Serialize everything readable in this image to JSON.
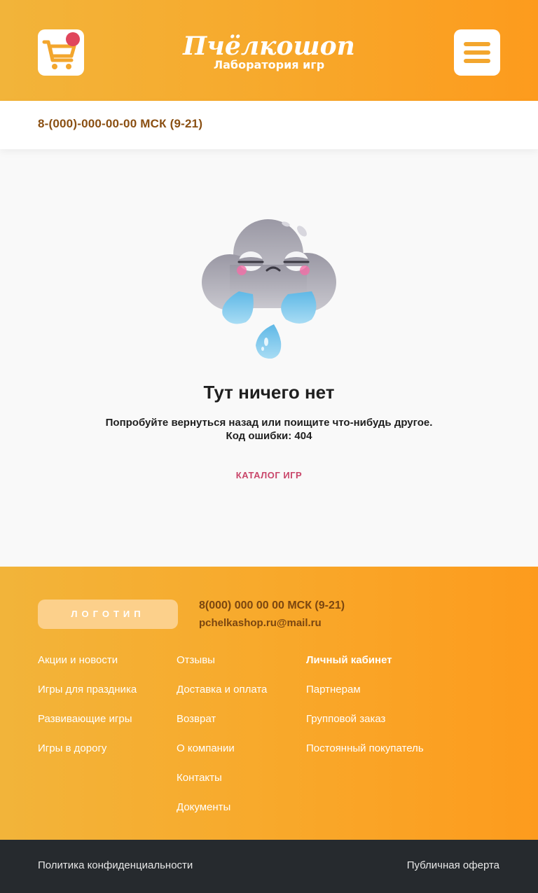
{
  "header": {
    "logo_name": "Пчёлкошоп",
    "logo_subtitle": "Лаборатория игр",
    "cart_icon": "cart-icon",
    "menu_icon": "hamburger-icon",
    "accent": "#f7a92c",
    "badge_color": "#e0465c"
  },
  "phone_bar": {
    "phone": "8-(000)-000-00-00 МСК (9-21)"
  },
  "error": {
    "illustration": "sad-cloud-icon",
    "title": "Тут ничего нет",
    "message": "Попробуйте вернуться назад или поищите что-нибудь другое.",
    "code_line": "Код ошибки: 404",
    "catalog_link": "КАТАЛОГ ИГР"
  },
  "footer": {
    "logo_placeholder": "ЛОГОТИП",
    "phone": "8(000) 000 00 00 МСК (9-21)",
    "email": "pchelkashop.ru@mail.ru",
    "col1": [
      "Акции и новости",
      "Игры для праздника",
      "Развивающие игры",
      "Игры в дорогу"
    ],
    "col2": [
      "Отзывы",
      "Доставка и оплата",
      "Возврат",
      "О компании",
      "Контакты",
      "Документы"
    ],
    "col3": [
      "Личный кабинет",
      "Партнерам",
      "Групповой заказ",
      "Постоянный покупатель"
    ]
  },
  "bottom": {
    "privacy": "Политика конфиденциальности",
    "offer": "Публичная оферта"
  }
}
